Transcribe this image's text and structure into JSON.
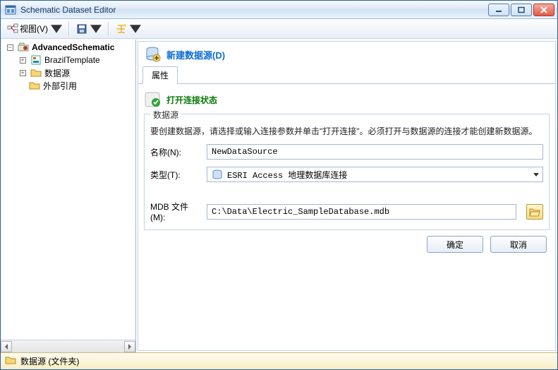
{
  "window": {
    "title": "Schematic Dataset Editor"
  },
  "toolbar": {
    "view_label": "视图(V)"
  },
  "tree": {
    "root": {
      "label": "AdvancedSchematic"
    },
    "items": [
      {
        "label": "BrazilTemplate"
      },
      {
        "label": "数据源"
      },
      {
        "label": "外部引用"
      }
    ]
  },
  "main": {
    "title": "新建数据源(D)",
    "tab_label": "属性",
    "status_text": "打开连接状态",
    "fieldset_title": "数据源",
    "description": "要创建数据源，请选择或输入连接参数并单击\"打开连接\"。必须打开与数据源的连接才能创建新数据源。",
    "name_label": "名称(N):",
    "name_value": "NewDataSource",
    "type_label": "类型(T):",
    "type_value": "ESRI Access 地理数据库连接",
    "file_label": "MDB 文件(M):",
    "file_value": "C:\\Data\\Electric_SampleDatabase.mdb",
    "ok_label": "确定",
    "cancel_label": "取消"
  },
  "statusbar": {
    "text": "数据源 (文件夹)"
  }
}
